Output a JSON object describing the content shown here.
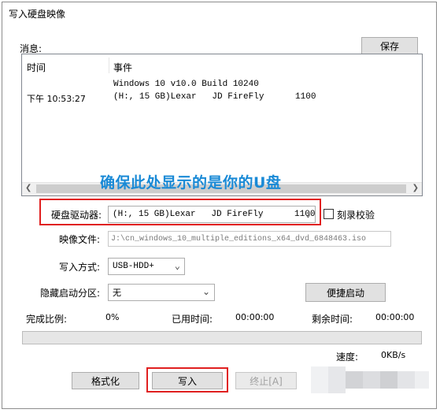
{
  "window": {
    "title": "写入硬盘映像"
  },
  "messages": {
    "label": "消息:",
    "save_label": "保存",
    "col_time": "时间",
    "col_event": "事件",
    "rows": [
      {
        "time": "",
        "event": "Windows 10 v10.0 Build 10240"
      },
      {
        "time": "下午 10:53:27",
        "event": "(H:, 15 GB)Lexar   JD FireFly      1100"
      }
    ]
  },
  "annotation": "确保此处显示的是你的U盘",
  "form": {
    "drive_label": "硬盘驱动器:",
    "drive_value": "(H:, 15 GB)Lexar   JD FireFly      1100",
    "verify_label": "刻录校验",
    "image_label": "映像文件:",
    "image_value": "J:\\cn_windows_10_multiple_editions_x64_dvd_6848463.iso",
    "method_label": "写入方式:",
    "method_value": "USB-HDD+",
    "hidden_label": "隐藏启动分区:",
    "hidden_value": "无",
    "quickboot_label": "便捷启动"
  },
  "status": {
    "complete_label": "完成比例:",
    "complete_value": "0%",
    "progress": 0,
    "elapsed_label": "已用时间:",
    "elapsed_value": "00:00:00",
    "remaining_label": "剩余时间:",
    "remaining_value": "00:00:00",
    "speed_label": "速度:",
    "speed_value": "0KB/s"
  },
  "actions": {
    "format_label": "格式化",
    "write_label": "写入",
    "stop_label": "终止[A]"
  },
  "colors": {
    "annotation": "#1a8ad6",
    "highlight_box": "#e02020"
  }
}
